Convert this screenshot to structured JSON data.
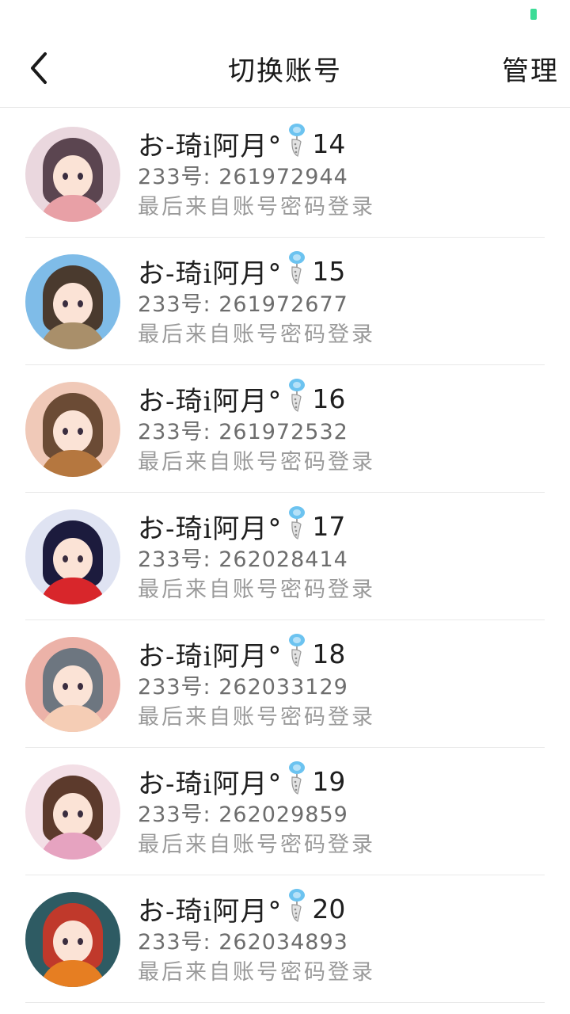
{
  "header": {
    "title": "切换账号",
    "manage_label": "管理"
  },
  "colors": {
    "accent": "#3ddc97",
    "charm_blue": "#6cc3f0"
  },
  "accounts": [
    {
      "name": "お-琦i阿月°",
      "suffix": "14",
      "uid": "233号: 261972944",
      "login_source": "最后来自账号密码登录",
      "avatar_colors": [
        "#ead7de",
        "#5b4550",
        "#e8a0a6"
      ]
    },
    {
      "name": "お-琦i阿月°",
      "suffix": "15",
      "uid": "233号: 261972677",
      "login_source": "最后来自账号密码登录",
      "avatar_colors": [
        "#7fbce8",
        "#4a3a2e",
        "#a98f6a"
      ]
    },
    {
      "name": "お-琦i阿月°",
      "suffix": "16",
      "uid": "233号: 261972532",
      "login_source": "最后来自账号密码登录",
      "avatar_colors": [
        "#f0c9b8",
        "#6b4b35",
        "#b5773f"
      ]
    },
    {
      "name": "お-琦i阿月°",
      "suffix": "17",
      "uid": "233号: 262028414",
      "login_source": "最后来自账号密码登录",
      "avatar_colors": [
        "#dfe3f2",
        "#1c1b3d",
        "#d8262b"
      ]
    },
    {
      "name": "お-琦i阿月°",
      "suffix": "18",
      "uid": "233号: 262033129",
      "login_source": "最后来自账号密码登录",
      "avatar_colors": [
        "#ecb2a8",
        "#6d7680",
        "#f5cdb5"
      ]
    },
    {
      "name": "お-琦i阿月°",
      "suffix": "19",
      "uid": "233号: 262029859",
      "login_source": "最后来自账号密码登录",
      "avatar_colors": [
        "#f3dfe6",
        "#5c3a2c",
        "#e6a3c0"
      ]
    },
    {
      "name": "お-琦i阿月°",
      "suffix": "20",
      "uid": "233号: 262034893",
      "login_source": "最后来自账号密码登录",
      "avatar_colors": [
        "#2e5b63",
        "#c0392b",
        "#e67e22"
      ]
    }
  ]
}
